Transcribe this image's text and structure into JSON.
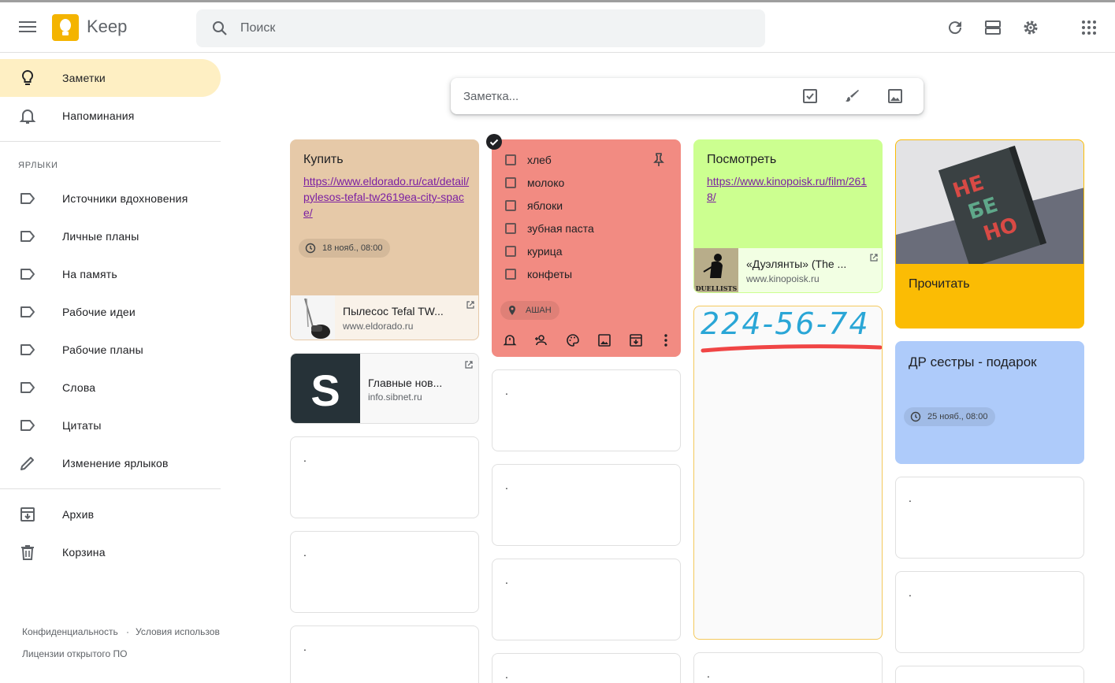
{
  "app": {
    "title": "Keep"
  },
  "search": {
    "placeholder": "Поиск"
  },
  "header_icons": [
    "refresh-icon",
    "list-view-icon",
    "settings-icon",
    "apps-icon"
  ],
  "sidebar": {
    "items": [
      {
        "label": "Заметки",
        "icon": "lightbulb-icon",
        "active": true
      },
      {
        "label": "Напоминания",
        "icon": "bell-icon"
      }
    ],
    "labels_title": "ЯРЛЫКИ",
    "labels": [
      {
        "label": "Источники вдохновения"
      },
      {
        "label": "Личные планы"
      },
      {
        "label": "На память"
      },
      {
        "label": "Рабочие идеи"
      },
      {
        "label": "Рабочие планы"
      },
      {
        "label": "Слова"
      },
      {
        "label": "Цитаты"
      }
    ],
    "edit_labels": "Изменение ярлыков",
    "archive": "Архив",
    "trash": "Корзина",
    "footer": {
      "privacy": "Конфиденциальность",
      "separator": "·",
      "terms": "Условия использов",
      "licenses": "Лицензии открытого ПО"
    }
  },
  "composer": {
    "placeholder": "Заметка..."
  },
  "notes": {
    "buy": {
      "title": "Купить",
      "link": "https://www.eldorado.ru/cat/detail/pylesos-tefal-tw2619ea-city-space/",
      "reminder": "18 нояб., 08:00",
      "preview_title": "Пылесос Tefal TW...",
      "preview_url": "www.eldorado.ru",
      "color": "#e6c9a8"
    },
    "sibnet": {
      "preview_title": "Главные нов...",
      "preview_url": "info.sibnet.ru",
      "thumb_letter": "S"
    },
    "checklist": {
      "items": [
        "хлеб",
        "молоко",
        "яблоки",
        "зубная паста",
        "курица",
        "конфеты"
      ],
      "location": "АШАН",
      "color": "#f28b82"
    },
    "watch": {
      "title": "Посмотреть",
      "link": "https://www.kinopoisk.ru/film/2618/",
      "preview_title": "«Дуэлянты» (The ...",
      "preview_url": "www.kinopoisk.ru",
      "thumb_caption": "DUELLISTS",
      "color": "#ccff90"
    },
    "phone": {
      "handwriting": "224-56-74"
    },
    "read": {
      "title": "Прочитать",
      "color": "#fbbc04"
    },
    "birthday": {
      "title": "ДР сестры - подарок",
      "reminder": "25 нояб., 08:00",
      "color": "#aecbfa"
    },
    "dot": "."
  }
}
